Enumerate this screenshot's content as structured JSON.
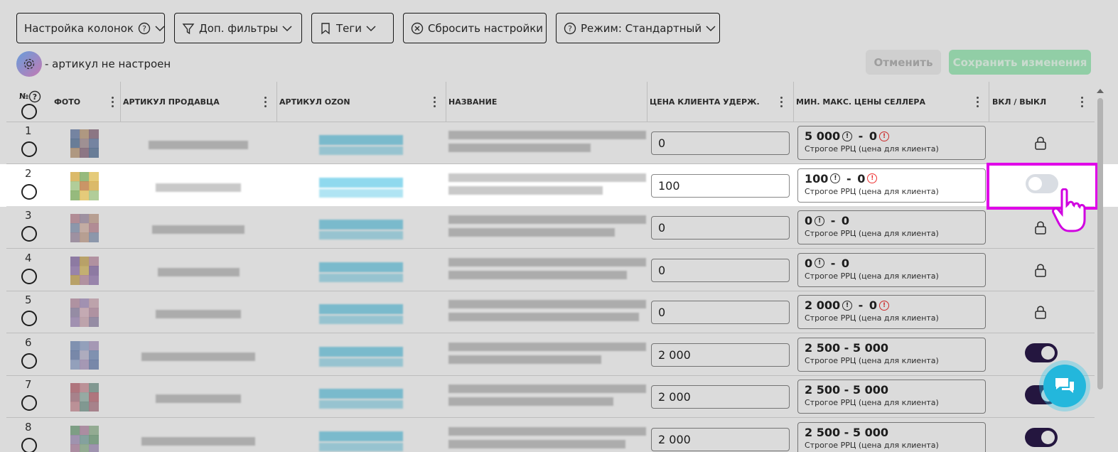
{
  "toolbar": {
    "columns": "Настройка колонок",
    "filters": "Доп. фильтры",
    "tags": "Теги",
    "reset": "Сбросить настройки",
    "mode": "Режим: Стандартный"
  },
  "sub_note": "- артикул не настроен",
  "cancel_label": "Отменить",
  "save_label": "Сохранить изменения",
  "columns": {
    "num": "№",
    "photo": "ФОТО",
    "seller_sku": "АРТИКУЛ ПРОДАВЦА",
    "ozon_sku": "АРТИКУЛ OZON",
    "name": "НАЗВАНИЕ",
    "client_price": "ЦЕНА КЛИЕНТА УДЕРЖ.",
    "minmax": "МИН. МАКС. ЦЕНЫ СЕЛЛЕРА",
    "toggle": "ВКЛ / ВЫКЛ"
  },
  "rows": [
    {
      "num": "1",
      "price": "0",
      "min": "5 000",
      "max": "0",
      "note": "Строгое РРЦ (цена для клиента)",
      "state": "locked"
    },
    {
      "num": "2",
      "price": "100",
      "min": "100",
      "max": "0",
      "note": "Строгое РРЦ (цена для клиента)",
      "state": "off"
    },
    {
      "num": "3",
      "price": "0",
      "min": "0",
      "max": "0",
      "note": "Строгое РРЦ (цена для клиента)",
      "state": "locked"
    },
    {
      "num": "4",
      "price": "0",
      "min": "0",
      "max": "0",
      "note": "Строгое РРЦ (цена для клиента)",
      "state": "locked"
    },
    {
      "num": "5",
      "price": "0",
      "min": "2 000",
      "max": "0",
      "note": "Строгое РРЦ (цена для клиента)",
      "state": "locked"
    },
    {
      "num": "6",
      "price": "2 000",
      "range": "2 500 - 5 000",
      "note": "Строгое РРЦ (цена для клиента)",
      "state": "on"
    },
    {
      "num": "7",
      "price": "2 000",
      "range": "2 500 - 5 000",
      "note": "Строгое РРЦ (цена для клиента)",
      "state": "on"
    },
    {
      "num": "8",
      "price": "2 000",
      "range": "2 500 - 5 000",
      "note": "Строгое РРЦ (цена для клиента)",
      "state": "on"
    }
  ],
  "colors": {
    "accent": "#e000e8",
    "toggle_on": "#2b1a4a",
    "chat": "#23b7dc",
    "save": "#a9f0c2"
  }
}
